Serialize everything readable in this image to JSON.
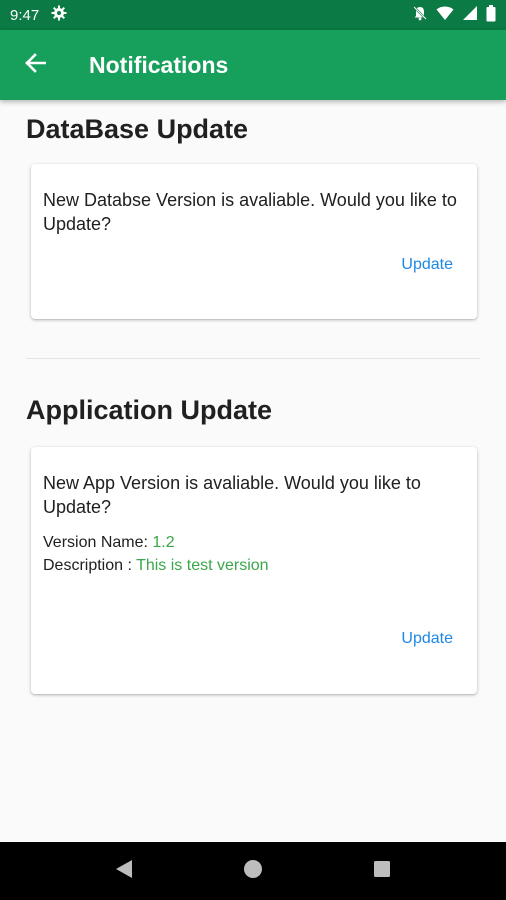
{
  "status_bar": {
    "time": "9:47",
    "icons": [
      "settings-icon",
      "notifications-off-icon",
      "wifi-icon",
      "signal-icon",
      "battery-icon"
    ]
  },
  "app_bar": {
    "title": "Notifications",
    "back_icon": "arrow-back-icon"
  },
  "sections": {
    "database": {
      "title": "DataBase Update",
      "message": "New Databse Version is avaliable. Would you like to Update?",
      "action_label": "Update"
    },
    "application": {
      "title": "Application Update",
      "message": "New App Version is avaliable. Would you like to Update?",
      "version_name_label": "Version Name:",
      "version_name_value": "1.2",
      "description_label": "Description :",
      "description_value": "This is test version",
      "action_label": "Update"
    }
  },
  "nav_bar": {
    "buttons": [
      "back-triangle-icon",
      "home-circle-icon",
      "recents-square-icon"
    ]
  },
  "colors": {
    "status_bar": "#0b7a44",
    "app_bar": "#16a05c",
    "action": "#1e88e5",
    "value_text": "#3aa74a"
  }
}
